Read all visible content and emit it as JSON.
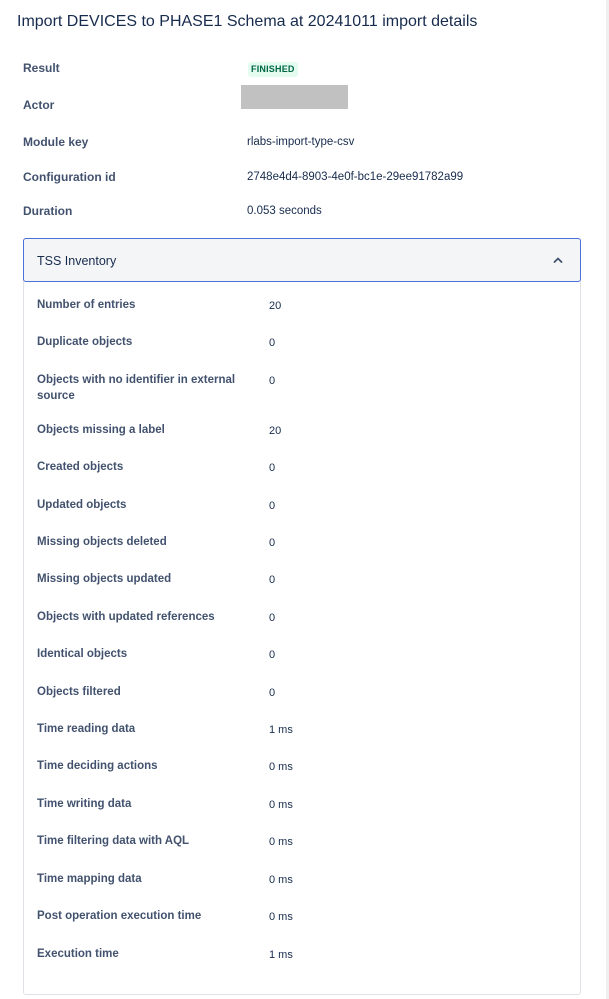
{
  "page": {
    "title": "Import DEVICES to PHASE1 Schema at 20241011 import details"
  },
  "summary": {
    "result_label": "Result",
    "result_value": "FINISHED",
    "actor_label": "Actor",
    "module_key_label": "Module key",
    "module_key_value": "rlabs-import-type-csv",
    "configuration_id_label": "Configuration id",
    "configuration_id_value": "2748e4d4-8903-4e0f-bc1e-29ee91782a99",
    "duration_label": "Duration",
    "duration_value": "0.053 seconds"
  },
  "panel": {
    "title": "TSS Inventory",
    "icon": "chevron-up-icon",
    "expanded": true,
    "stats": [
      {
        "label": "Number of entries",
        "value": "20"
      },
      {
        "label": "Duplicate objects",
        "value": "0"
      },
      {
        "label": "Objects with no identifier in external source",
        "value": "0"
      },
      {
        "label": "Objects missing a label",
        "value": "20"
      },
      {
        "label": "Created objects",
        "value": "0"
      },
      {
        "label": "Updated objects",
        "value": "0"
      },
      {
        "label": "Missing objects deleted",
        "value": "0"
      },
      {
        "label": "Missing objects updated",
        "value": "0"
      },
      {
        "label": "Objects with updated references",
        "value": "0"
      },
      {
        "label": "Identical objects",
        "value": "0"
      },
      {
        "label": "Objects filtered",
        "value": "0"
      },
      {
        "label": "Time reading data",
        "value": "1 ms"
      },
      {
        "label": "Time deciding actions",
        "value": "0 ms"
      },
      {
        "label": "Time writing data",
        "value": "0 ms"
      },
      {
        "label": "Time filtering data with AQL",
        "value": "0 ms"
      },
      {
        "label": "Time mapping data",
        "value": "0 ms"
      },
      {
        "label": "Post operation execution time",
        "value": "0 ms"
      },
      {
        "label": "Execution time",
        "value": "1 ms"
      }
    ]
  },
  "colors": {
    "text_primary": "#172b4d",
    "text_label": "#42526e",
    "status_success_bg": "#e3fcef",
    "status_success_text": "#006644",
    "panel_header_bg": "#f4f5f7",
    "panel_focus_border": "#4c6fd8"
  }
}
